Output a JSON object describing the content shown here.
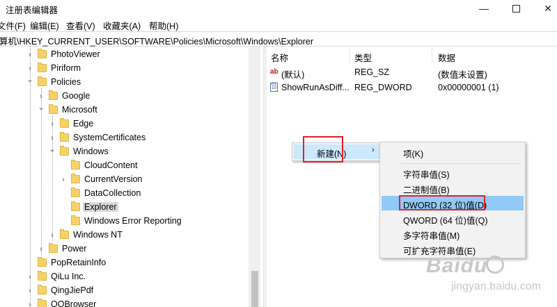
{
  "window": {
    "title": "注册表编辑器",
    "minimize_glyph": "—",
    "close_glyph": "✕"
  },
  "menu": [
    "文件(F)",
    "编辑(E)",
    "查看(V)",
    "收藏夹(A)",
    "帮助(H)"
  ],
  "address": "算机\\HKEY_CURRENT_USER\\SOFTWARE\\Policies\\Microsoft\\Windows\\Explorer",
  "tree": [
    {
      "label": "PhotoViewer",
      "level": 0,
      "expander": "collapsed"
    },
    {
      "label": "Piriform",
      "level": 0,
      "expander": "collapsed"
    },
    {
      "label": "Policies",
      "level": 0,
      "expander": "expanded"
    },
    {
      "label": "Google",
      "level": 1,
      "expander": "collapsed"
    },
    {
      "label": "Microsoft",
      "level": 1,
      "expander": "expanded"
    },
    {
      "label": "Edge",
      "level": 2,
      "expander": "collapsed"
    },
    {
      "label": "SystemCertificates",
      "level": 2,
      "expander": "collapsed"
    },
    {
      "label": "Windows",
      "level": 2,
      "expander": "expanded"
    },
    {
      "label": "CloudContent",
      "level": 3,
      "expander": "none"
    },
    {
      "label": "CurrentVersion",
      "level": 3,
      "expander": "collapsed"
    },
    {
      "label": "DataCollection",
      "level": 3,
      "expander": "none"
    },
    {
      "label": "Explorer",
      "level": 3,
      "expander": "none",
      "selected": true
    },
    {
      "label": "Windows Error Reporting",
      "level": 3,
      "expander": "none"
    },
    {
      "label": "Windows NT",
      "level": 2,
      "expander": "collapsed"
    },
    {
      "label": "Power",
      "level": 1,
      "expander": "collapsed"
    },
    {
      "label": "PopRetainInfo",
      "level": 0,
      "expander": "none"
    },
    {
      "label": "QiLu Inc.",
      "level": 0,
      "expander": "collapsed"
    },
    {
      "label": "QingJiePdf",
      "level": 0,
      "expander": "collapsed"
    },
    {
      "label": "QQBrowser",
      "level": 0,
      "expander": "collapsed"
    }
  ],
  "columns": {
    "name": "名称",
    "type": "类型",
    "data": "数据"
  },
  "values": [
    {
      "name": "(默认)",
      "type": "REG_SZ",
      "data": "(数值未设置)",
      "icon": "string-value-icon"
    },
    {
      "name": "ShowRunAsDiff...",
      "type": "REG_DWORD",
      "data": "0x00000001 (1)",
      "icon": "binary-value-icon"
    }
  ],
  "context_menu": {
    "new_label": "新建(N)",
    "arrow": "›"
  },
  "submenu": {
    "key_item": "项(K)",
    "items": [
      "字符串值(S)",
      "二进制值(B)",
      "DWORD (32 位)值(D)",
      "QWORD (64 位)值(Q)",
      "多字符串值(M)",
      "可扩充字符串值(E)"
    ],
    "highlighted_index": 2
  },
  "watermark": {
    "brand": "Baidu",
    "site": "jingyan.baidu.com"
  },
  "colors": {
    "selection": "#91c9f7",
    "annotation": "#e0202a",
    "folder": "#f6d26b"
  }
}
